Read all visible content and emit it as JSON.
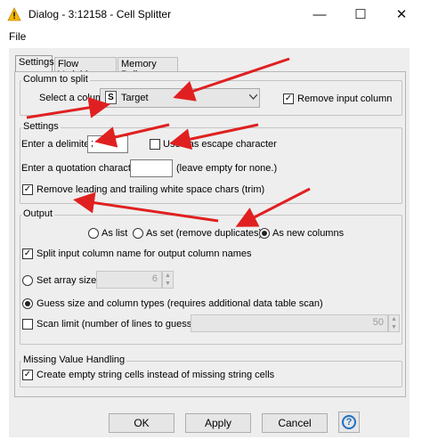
{
  "window": {
    "title": "Dialog - 3:12158 - Cell Splitter",
    "minimize_glyph": "—",
    "maximize_glyph": "☐",
    "close_glyph": "✕",
    "app_icon": "warning-triangle-icon"
  },
  "menu": {
    "file": "File"
  },
  "tabs": [
    {
      "label": "Settings",
      "active": true
    },
    {
      "label": "Flow Variables",
      "active": false
    },
    {
      "label": "Memory Policy",
      "active": false
    }
  ],
  "column_group": {
    "legend": "Column to split",
    "select_label": "Select a column:",
    "type_badge": "S",
    "selected_column": "Target",
    "remove_input_label": "Remove input column",
    "remove_input_checked": true
  },
  "settings_group": {
    "legend": "Settings",
    "delimiter_label": "Enter a delimiter:",
    "delimiter_value": ";",
    "use_escape_label": "Use \\ as escape character",
    "use_escape_checked": false,
    "quote_label": "Enter a quotation character:",
    "quote_value": "",
    "quote_hint": "(leave empty for none.)",
    "trim_label": "Remove leading and trailing white space chars (trim)",
    "trim_checked": true
  },
  "output_group": {
    "legend": "Output",
    "as_list_label": "As list",
    "as_set_label": "As set (remove duplicates)",
    "as_new_columns_label": "As new columns",
    "selected_output": "As new columns",
    "split_name_label": "Split input column name for output column names",
    "split_name_checked": true,
    "set_array_size_label": "Set array size",
    "array_size_value": "6",
    "guess_label": "Guess size and column types (requires additional data table scan)",
    "selected_size_mode": "guess",
    "scan_limit_label": "Scan limit (number of lines to guess on)",
    "scan_limit_checked": false,
    "scan_limit_value": "50"
  },
  "missing_group": {
    "legend": "Missing Value Handling",
    "empty_cells_label": "Create empty string cells instead of missing string cells",
    "empty_cells_checked": true
  },
  "buttons": {
    "ok": "OK",
    "apply": "Apply",
    "cancel": "Cancel",
    "help": "?"
  },
  "colors": {
    "annotation_arrow": "#e02020",
    "help_icon": "#1f6fc4",
    "warning_icon": "#f5b800"
  }
}
